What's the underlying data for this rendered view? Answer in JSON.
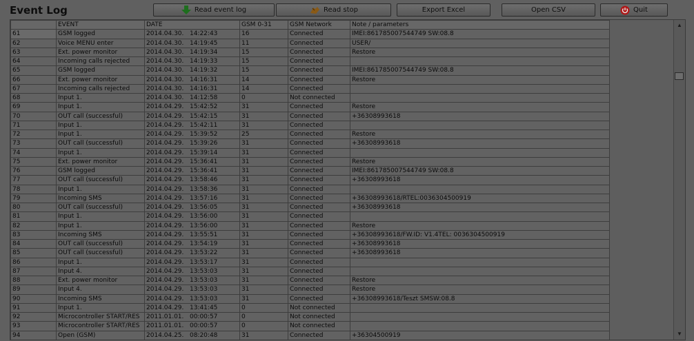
{
  "window": {
    "title": "Event Log"
  },
  "toolbar": {
    "read_event_log": "Read event log",
    "read_stop": "Read stop",
    "export_excel": "Export Excel",
    "open_csv": "Open CSV",
    "quit": "Quit"
  },
  "columns": [
    "",
    "EVENT",
    "DATE",
    "GSM 0-31",
    "GSM Network",
    "Note / parameters"
  ],
  "rows": [
    [
      "61",
      "GSM logged",
      "2014.04.30.   14:22:43",
      "16",
      "Connected",
      "IMEI:861785007544749 SW:08.8"
    ],
    [
      "62",
      "Voice MENU enter",
      "2014.04.30.   14:19:45",
      "11",
      "Connected",
      "USER/"
    ],
    [
      "63",
      "Ext. power monitor",
      "2014.04.30.   14:19:34",
      "15",
      "Connected",
      "Restore"
    ],
    [
      "64",
      "Incoming calls rejected",
      "2014.04.30.   14:19:33",
      "15",
      "Connected",
      ""
    ],
    [
      "65",
      "GSM logged",
      "2014.04.30.   14:19:32",
      "15",
      "Connected",
      "IMEI:861785007544749 SW:08.8"
    ],
    [
      "66",
      "Ext. power monitor",
      "2014.04.30.   14:16:31",
      "14",
      "Connected",
      "Restore"
    ],
    [
      "67",
      "Incoming calls rejected",
      "2014.04.30.   14:16:31",
      "14",
      "Connected",
      ""
    ],
    [
      "68",
      "Input 1.",
      "2014.04.30.   14:12:58",
      "0",
      "Not connected",
      ""
    ],
    [
      "69",
      "Input 1.",
      "2014.04.29.   15:42:52",
      "31",
      "Connected",
      "Restore"
    ],
    [
      "70",
      "OUT call (successful)",
      "2014.04.29.   15:42:15",
      "31",
      "Connected",
      "+36308993618"
    ],
    [
      "71",
      "Input 1.",
      "2014.04.29.   15:42:11",
      "31",
      "Connected",
      ""
    ],
    [
      "72",
      "Input 1.",
      "2014.04.29.   15:39:52",
      "25",
      "Connected",
      "Restore"
    ],
    [
      "73",
      "OUT call (successful)",
      "2014.04.29.   15:39:26",
      "31",
      "Connected",
      "+36308993618"
    ],
    [
      "74",
      "Input 1.",
      "2014.04.29.   15:39:14",
      "31",
      "Connected",
      ""
    ],
    [
      "75",
      "Ext. power monitor",
      "2014.04.29.   15:36:41",
      "31",
      "Connected",
      "Restore"
    ],
    [
      "76",
      "GSM logged",
      "2014.04.29.   15:36:41",
      "31",
      "Connected",
      "IMEI:861785007544749 SW:08.8"
    ],
    [
      "77",
      "OUT call (successful)",
      "2014.04.29.   13:58:46",
      "31",
      "Connected",
      "+36308993618"
    ],
    [
      "78",
      "Input 1.",
      "2014.04.29.   13:58:36",
      "31",
      "Connected",
      ""
    ],
    [
      "79",
      "Incoming SMS",
      "2014.04.29.   13:57:16",
      "31",
      "Connected",
      "+36308993618/RTEL:0036304500919"
    ],
    [
      "80",
      "OUT call (successful)",
      "2014.04.29.   13:56:05",
      "31",
      "Connected",
      "+36308993618"
    ],
    [
      "81",
      "Input 1.",
      "2014.04.29.   13:56:00",
      "31",
      "Connected",
      ""
    ],
    [
      "82",
      "Input 1.",
      "2014.04.29.   13:56:00",
      "31",
      "Connected",
      "Restore"
    ],
    [
      "83",
      "Incoming SMS",
      "2014.04.29.   13:55:51",
      "31",
      "Connected",
      "+36308993618/FW.ID: V1.4TEL: 0036304500919"
    ],
    [
      "84",
      "OUT call (successful)",
      "2014.04.29.   13:54:19",
      "31",
      "Connected",
      "+36308993618"
    ],
    [
      "85",
      "OUT call (successful)",
      "2014.04.29.   13:53:22",
      "31",
      "Connected",
      "+36308993618"
    ],
    [
      "86",
      "Input 1.",
      "2014.04.29.   13:53:17",
      "31",
      "Connected",
      ""
    ],
    [
      "87",
      "Input 4.",
      "2014.04.29.   13:53:03",
      "31",
      "Connected",
      ""
    ],
    [
      "88",
      "Ext. power monitor",
      "2014.04.29.   13:53:03",
      "31",
      "Connected",
      "Restore"
    ],
    [
      "89",
      "Input 4.",
      "2014.04.29.   13:53:03",
      "31",
      "Connected",
      "Restore"
    ],
    [
      "90",
      "Incoming SMS",
      "2014.04.29.   13:53:03",
      "31",
      "Connected",
      "+36308993618/Teszt SMSW:08.8"
    ],
    [
      "91",
      "Input 1.",
      "2014.04.29.   13:41:45",
      "0",
      "Not connected",
      ""
    ],
    [
      "92",
      "Microcontroller START/RES",
      "2011.01.01.   00:00:57",
      "0",
      "Not connected",
      ""
    ],
    [
      "93",
      "Microcontroller START/RES",
      "2011.01.01.   00:00:57",
      "0",
      "Not connected",
      ""
    ],
    [
      "94",
      "Open (GSM)",
      "2014.04.25.   08:20:48",
      "31",
      "Connected",
      "+36304500919"
    ]
  ],
  "scrollbar": {
    "up_arrow": "▲",
    "down_arrow": "▼"
  },
  "colors": {
    "accent_green": "#1e6e1e",
    "quit_red": "#b01818"
  }
}
